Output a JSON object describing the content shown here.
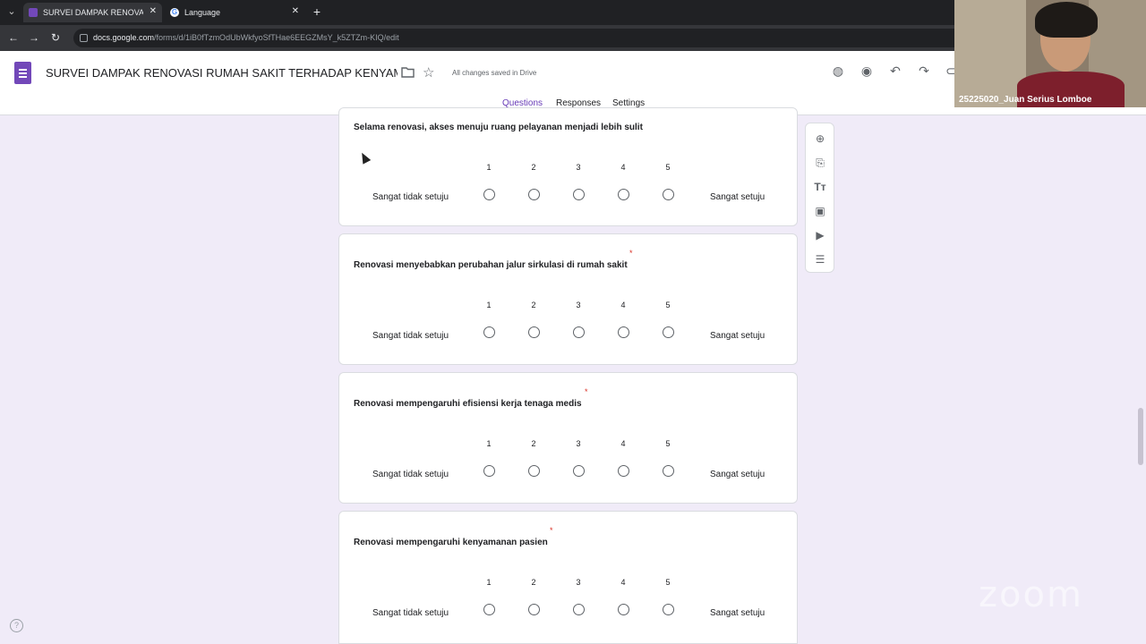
{
  "browser": {
    "tabs": [
      {
        "title": "SURVEI DAMPAK RENOVASI RU",
        "active": true
      },
      {
        "title": "Language",
        "active": false
      }
    ],
    "url_host": "docs.google.com",
    "url_path": "/forms/d/1iB0fTzmOdUbWkfyoSfTHae6EEGZMsY_k5ZTZm-KIQ/edit"
  },
  "form": {
    "title": "SURVEI DAMPAK RENOVASI RUMAH SAKIT TERHADAP KENYAMANAN DAI",
    "saved_status": "All changes saved in Drive",
    "tabs": [
      {
        "label": "Questions",
        "active": true
      },
      {
        "label": "Responses",
        "active": false
      },
      {
        "label": "Settings",
        "active": false
      }
    ]
  },
  "questions": [
    {
      "title": "Selama renovasi, akses menuju ruang pelayanan menjadi lebih sulit",
      "required": false,
      "scale": [
        "1",
        "2",
        "3",
        "4",
        "5"
      ],
      "low_label": "Sangat tidak setuju",
      "high_label": "Sangat setuju"
    },
    {
      "title": "Renovasi menyebabkan perubahan jalur sirkulasi di rumah sakit",
      "required": true,
      "required_mark": "*",
      "scale": [
        "1",
        "2",
        "3",
        "4",
        "5"
      ],
      "low_label": "Sangat tidak setuju",
      "high_label": "Sangat setuju"
    },
    {
      "title": "Renovasi mempengaruhi efisiensi kerja tenaga medis",
      "required": true,
      "required_mark": "*",
      "scale": [
        "1",
        "2",
        "3",
        "4",
        "5"
      ],
      "low_label": "Sangat tidak setuju",
      "high_label": "Sangat setuju"
    },
    {
      "title": "Renovasi mempengaruhi kenyamanan pasien",
      "required": true,
      "required_mark": "*",
      "scale": [
        "1",
        "2",
        "3",
        "4",
        "5"
      ],
      "low_label": "Sangat tidak setuju",
      "high_label": "Sangat setuju"
    }
  ],
  "webcam": {
    "participant_name": "25225020_Juan Serius Lomboe"
  },
  "watermark": "zoom",
  "help_glyph": "?",
  "colors": {
    "accent": "#673ab7",
    "page_bg": "#f0ebf8",
    "required": "#d93025"
  }
}
